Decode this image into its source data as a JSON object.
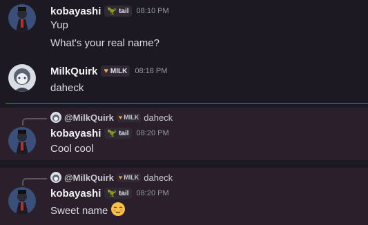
{
  "messages": [
    {
      "username": "kobayashi",
      "tag": "tail",
      "time": "08:10 PM",
      "lines": [
        "Yup",
        "What's your real name?"
      ]
    },
    {
      "username": "MilkQuirk",
      "tag": "MILK",
      "time": "08:18 PM",
      "lines": [
        "daheck"
      ]
    },
    {
      "reply": {
        "username": "@MilkQuirk",
        "tag": "MILK",
        "text": "daheck"
      },
      "username": "kobayashi",
      "tag": "tail",
      "time": "08:20 PM",
      "lines": [
        "Cool cool"
      ]
    },
    {
      "reply": {
        "username": "@MilkQuirk",
        "tag": "MILK",
        "text": "daheck"
      },
      "username": "kobayashi",
      "tag": "tail",
      "time": "08:20 PM",
      "lines": [
        "Sweet name"
      ],
      "emoji": "relieved-face"
    }
  ],
  "colors": {
    "background": "#1d1923",
    "highlight": "#2a1f2a",
    "divider": "#d34b54",
    "timestamp": "#949ba4"
  }
}
